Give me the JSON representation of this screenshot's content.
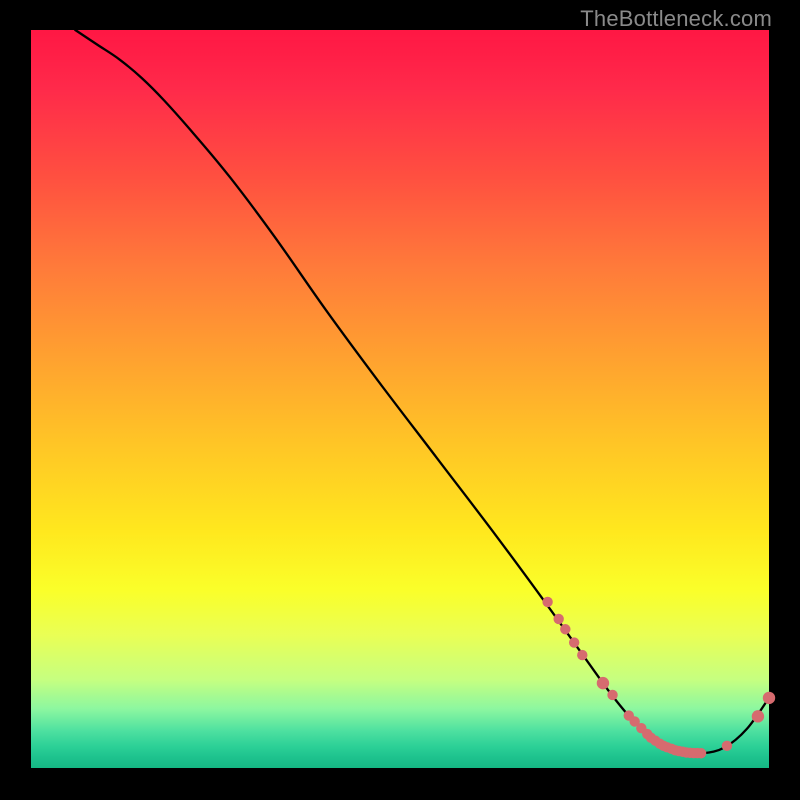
{
  "watermark": "TheBottleneck.com",
  "chart_data": {
    "type": "line",
    "title": "",
    "xlabel": "",
    "ylabel": "",
    "xlim": [
      0,
      100
    ],
    "ylim": [
      0,
      100
    ],
    "grid": false,
    "legend": false,
    "curve": {
      "x": [
        6,
        9,
        12,
        15,
        18,
        22,
        27,
        33,
        40,
        47,
        55,
        63,
        70,
        75,
        79,
        82,
        85,
        88,
        91,
        94,
        97,
        100
      ],
      "y": [
        100,
        98,
        96,
        93.5,
        90.5,
        86,
        80,
        72,
        62,
        52.5,
        42,
        31.5,
        22,
        15,
        9.5,
        6,
        3.5,
        2.2,
        2,
        2.8,
        5.3,
        9.5
      ]
    },
    "points": {
      "color": "#d66b6f",
      "radius_small": 5.2,
      "radius_large": 6.2,
      "data": [
        {
          "x": 70.0,
          "y": 22.5,
          "r": "small"
        },
        {
          "x": 71.5,
          "y": 20.2,
          "r": "small"
        },
        {
          "x": 72.4,
          "y": 18.8,
          "r": "small"
        },
        {
          "x": 73.6,
          "y": 17.0,
          "r": "small"
        },
        {
          "x": 74.7,
          "y": 15.3,
          "r": "small"
        },
        {
          "x": 77.5,
          "y": 11.5,
          "r": "large"
        },
        {
          "x": 78.8,
          "y": 9.9,
          "r": "small"
        },
        {
          "x": 81.0,
          "y": 7.1,
          "r": "small"
        },
        {
          "x": 81.8,
          "y": 6.3,
          "r": "small"
        },
        {
          "x": 82.7,
          "y": 5.4,
          "r": "small"
        },
        {
          "x": 83.5,
          "y": 4.6,
          "r": "small"
        },
        {
          "x": 84.0,
          "y": 4.1,
          "r": "small"
        },
        {
          "x": 84.6,
          "y": 3.7,
          "r": "small"
        },
        {
          "x": 85.2,
          "y": 3.3,
          "r": "small"
        },
        {
          "x": 85.7,
          "y": 3.0,
          "r": "small"
        },
        {
          "x": 86.2,
          "y": 2.8,
          "r": "small"
        },
        {
          "x": 86.8,
          "y": 2.6,
          "r": "small"
        },
        {
          "x": 87.3,
          "y": 2.4,
          "r": "small"
        },
        {
          "x": 87.8,
          "y": 2.3,
          "r": "small"
        },
        {
          "x": 88.3,
          "y": 2.2,
          "r": "small"
        },
        {
          "x": 88.8,
          "y": 2.1,
          "r": "small"
        },
        {
          "x": 89.3,
          "y": 2.05,
          "r": "small"
        },
        {
          "x": 89.8,
          "y": 2.03,
          "r": "small"
        },
        {
          "x": 90.3,
          "y": 2.02,
          "r": "small"
        },
        {
          "x": 90.8,
          "y": 2.0,
          "r": "small"
        },
        {
          "x": 94.3,
          "y": 3.0,
          "r": "small"
        },
        {
          "x": 98.5,
          "y": 7.0,
          "r": "large"
        },
        {
          "x": 100.0,
          "y": 9.5,
          "r": "large"
        }
      ]
    }
  }
}
